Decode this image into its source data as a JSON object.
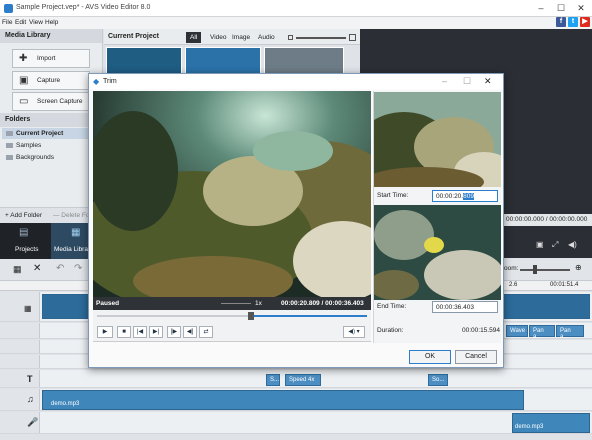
{
  "app": {
    "title": "Sample Project.vep* - AVS Video Editor 8.0",
    "menu": [
      "File",
      "Edit",
      "View",
      "Help"
    ],
    "social": [
      "f",
      "t",
      "▶"
    ]
  },
  "media_library": {
    "header": "Media Library",
    "buttons": [
      "Import",
      "Capture",
      "Screen Capture"
    ],
    "folders_header": "Folders",
    "folders": [
      "Current Project",
      "Samples",
      "Backgrounds"
    ],
    "add_folder": "+ Add Folder",
    "delete_folder": "— Delete Fol"
  },
  "current_project": {
    "header": "Current Project",
    "tabs": [
      "All",
      "Video",
      "Image",
      "Audio"
    ]
  },
  "nav": {
    "projects": "Projects",
    "media_library": "Media Library"
  },
  "preview": {
    "time_readout": "00:00:00.000 / 00:00:00.000",
    "zoom_label": "oom:"
  },
  "timeline": {
    "ruler": [
      "2.6",
      "00:01:51.4"
    ],
    "effect_clips": [
      "Wave",
      "Pan a...",
      "Pan a..."
    ],
    "text_clips": [
      "S...",
      "Speed 4x",
      "So..."
    ],
    "audio_clips": [
      "demo.mp3",
      "demo.mp3"
    ]
  },
  "trim": {
    "title": "Trim",
    "status": "Paused",
    "speed": "1x",
    "time": "00:00:20.809 / 00:00:36.403",
    "start_label": "Start Time:",
    "start_value": "00:00:20.",
    "start_selected": "809",
    "end_label": "End Time:",
    "end_value": "00:00:36.403",
    "duration_label": "Duration:",
    "duration_value": "00:00:15.594",
    "ok": "OK",
    "cancel": "Cancel"
  }
}
